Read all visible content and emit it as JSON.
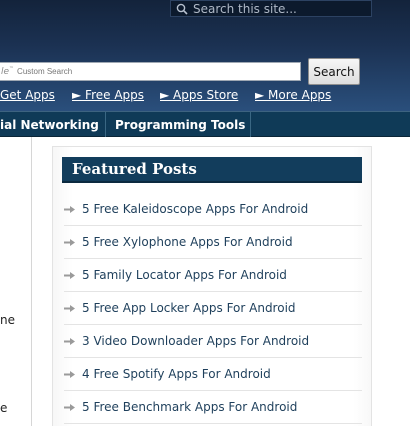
{
  "header": {
    "site_search_placeholder": "Search this site...",
    "cse_logo": "le",
    "cse_logo_tm": "™",
    "cse_label": "Custom Search",
    "cse_button": "Search"
  },
  "top_links": [
    {
      "label": "Get Apps"
    },
    {
      "label": "► Free Apps"
    },
    {
      "label": "► Apps Store"
    },
    {
      "label": "► More Apps"
    }
  ],
  "nav": [
    {
      "label": "ial Networking"
    },
    {
      "label": "Programming Tools"
    }
  ],
  "left_fragments": [
    "ne",
    "e"
  ],
  "featured": {
    "title": "Featured Posts",
    "posts": [
      {
        "title": "5 Free Kaleidoscope Apps For Android"
      },
      {
        "title": "5 Free Xylophone Apps For Android"
      },
      {
        "title": "5 Family Locator Apps For Android"
      },
      {
        "title": "5 Free App Locker Apps For Android"
      },
      {
        "title": "3 Video Downloader Apps For Android"
      },
      {
        "title": "4 Free Spotify Apps For Android"
      },
      {
        "title": "5 Free Benchmark Apps For Android"
      }
    ]
  },
  "colors": {
    "header_dark": "#13233b",
    "nav_bar": "#0f3a57",
    "widget_title_bg": "#123d5c",
    "post_text": "#1e3f5b"
  }
}
